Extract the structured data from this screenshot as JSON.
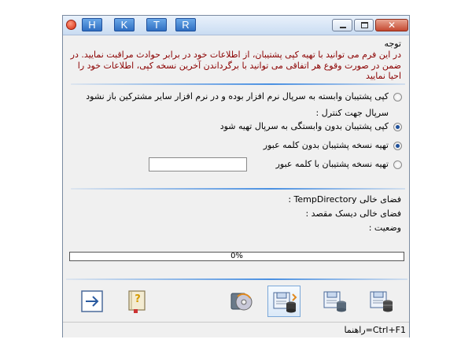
{
  "titlebar": {
    "shortcut_buttons": [
      "H",
      "K",
      "T",
      "R"
    ],
    "close_glyph": "✕"
  },
  "notice": {
    "title": "توجه",
    "body": "در این فرم می توانید با تهیه کپی پشتیبان، از اطلاعات خود در برابر حوادث مراقبت نمایید. در ضمن در صورت وقوع هر اتفاقی می توانید با برگرداندن آخرین نسخه کپی، اطلاعات خود را احیا نمایید"
  },
  "options": {
    "server_dependent_label": "کپی پشتیبان وابسته به سرپال نرم افزار بوده و در نرم افزار سایر مشترکین باز نشود",
    "server_control_label": "سرپال جهت کنترل :",
    "server_independent_label": "کپی پشتیبان بدون وابستگی به سرپال تهیه شود",
    "no_password_label": "تهیه نسخه پشتیبان بدون کلمه عبور",
    "with_password_label": "تهیه نسخه پشتیبان با کلمه عبور",
    "password_value": ""
  },
  "info": {
    "temp_directory": "فضای خالی TempDirectory :",
    "target_disk": "فضای خالی دیسک مقصد   :",
    "status": "وضعیت :"
  },
  "progress": {
    "percent": 0,
    "label": "0%"
  },
  "toolbar": {
    "icons": [
      "exit-arrow-icon",
      "help-book-icon",
      "restore-cd-icon",
      "backup-save-icon",
      "backup-password-icon",
      "backup-database-icon"
    ]
  },
  "statusbar": {
    "help_hint": "راهنما=Ctrl+F1"
  },
  "colors": {
    "notice_text": "#8b0000",
    "accent": "#4a90e2"
  }
}
